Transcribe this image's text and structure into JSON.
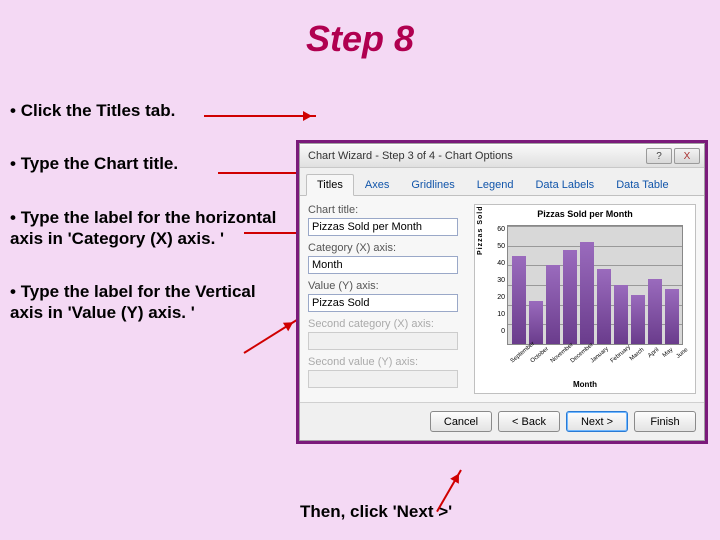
{
  "slide": {
    "title": "Step 8",
    "bullets": [
      "Click the Titles tab.",
      "Type the Chart title.",
      "Type the label for the horizontal axis in 'Category (X) axis. '",
      "Type the label for the Vertical axis in 'Value (Y) axis. '"
    ],
    "footer": "Then, click 'Next >'"
  },
  "dialog": {
    "title": "Chart Wizard - Step 3 of 4 - Chart Options",
    "win_help": "?",
    "win_close": "X",
    "tabs": [
      "Titles",
      "Axes",
      "Gridlines",
      "Legend",
      "Data Labels",
      "Data Table"
    ],
    "active_tab": 0,
    "fields": {
      "chart_title_label": "Chart title:",
      "chart_title_value": "Pizzas Sold per Month",
      "cat_x_label": "Category (X) axis:",
      "cat_x_value": "Month",
      "val_y_label": "Value (Y) axis:",
      "val_y_value": "Pizzas Sold",
      "sec_x_label": "Second category (X) axis:",
      "sec_x_value": "",
      "sec_y_label": "Second value (Y) axis:",
      "sec_y_value": ""
    },
    "buttons": {
      "cancel": "Cancel",
      "back": "< Back",
      "next": "Next >",
      "finish": "Finish"
    }
  },
  "chart_data": {
    "type": "bar",
    "title": "Pizzas Sold per Month",
    "xlabel": "Month",
    "ylabel": "Pizzas Sold",
    "ylim": [
      0,
      60
    ],
    "yticks": [
      0,
      10,
      20,
      30,
      40,
      50,
      60
    ],
    "categories": [
      "September",
      "October",
      "November",
      "December",
      "January",
      "February",
      "March",
      "April",
      "May",
      "June"
    ],
    "values": [
      45,
      22,
      40,
      48,
      52,
      38,
      30,
      25,
      33,
      28
    ]
  }
}
